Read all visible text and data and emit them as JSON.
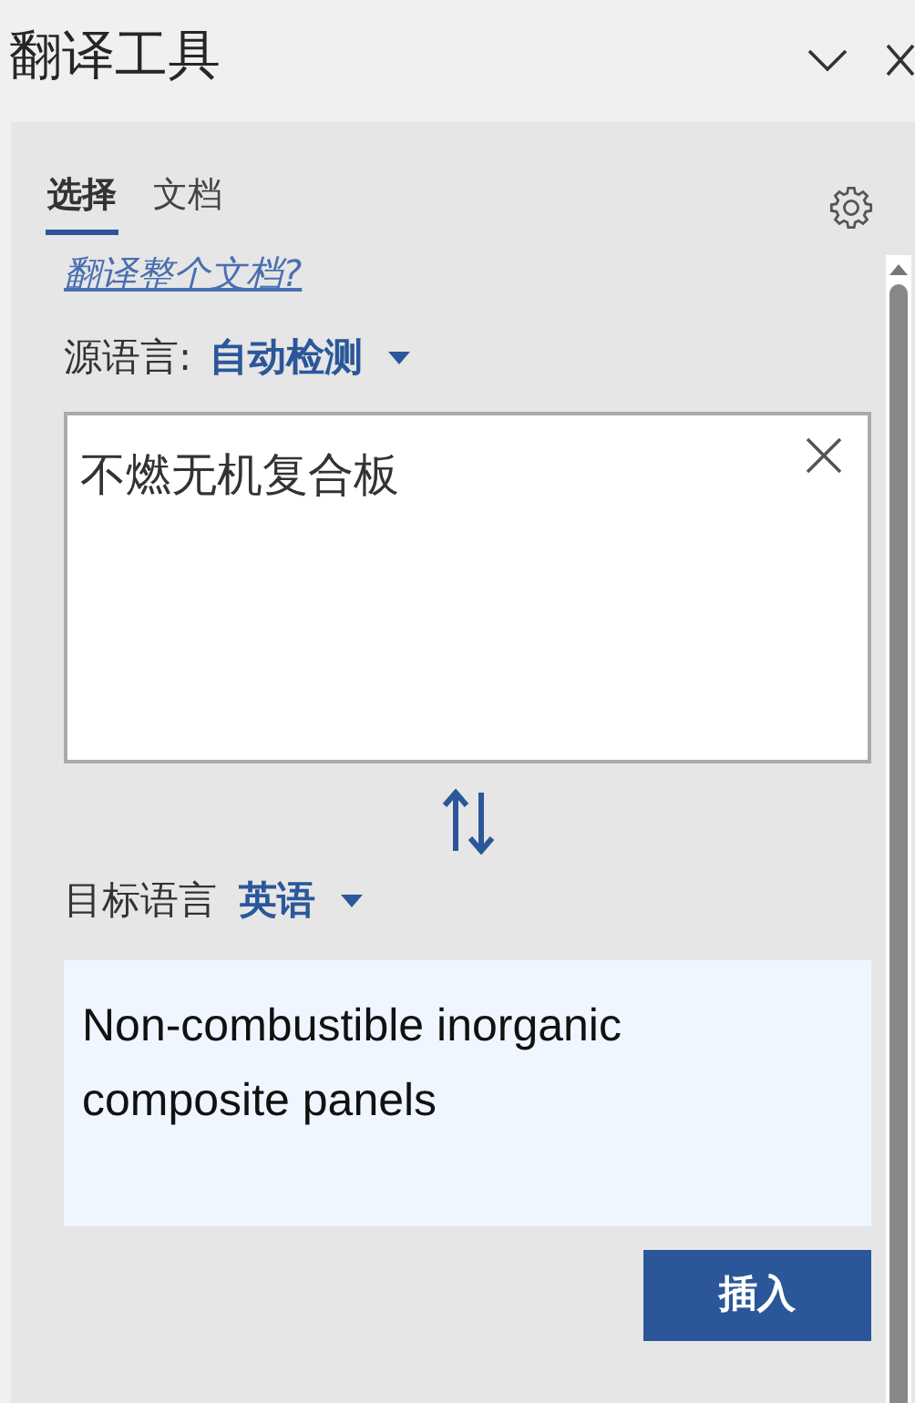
{
  "window": {
    "title": "翻译工具"
  },
  "tabs": [
    {
      "label": "选择",
      "selected": true
    },
    {
      "label": "文档",
      "selected": false
    }
  ],
  "link": "翻译整个文档?",
  "source": {
    "label": "源语言:",
    "value": "自动检测"
  },
  "input": {
    "value": "不燃无机复合板"
  },
  "target": {
    "label": "目标语言",
    "value": "英语"
  },
  "output": "Non-combustible inorganic composite panels",
  "button": "插入"
}
